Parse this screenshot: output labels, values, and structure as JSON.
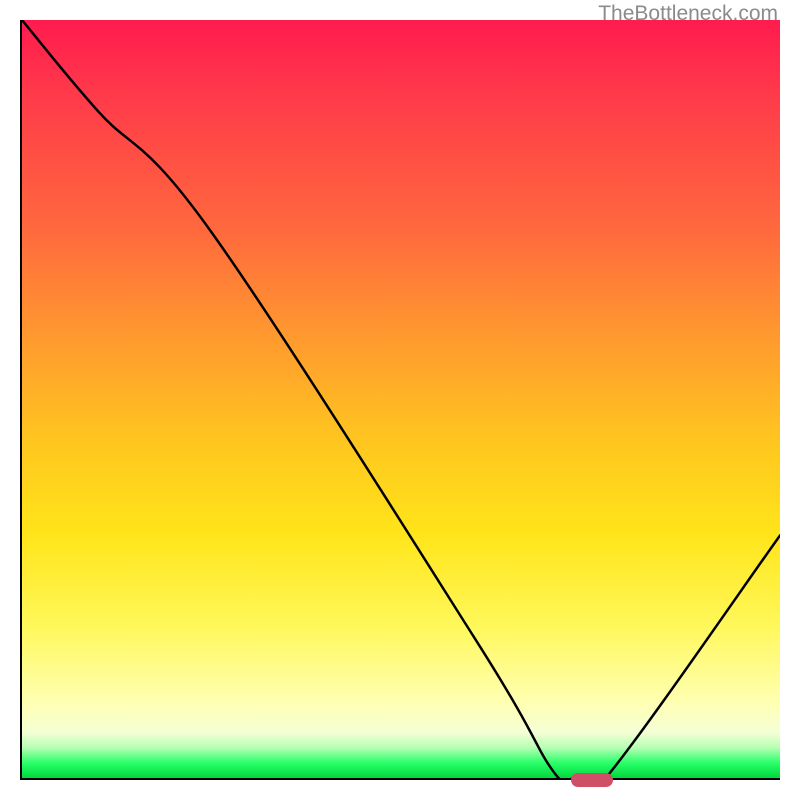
{
  "watermark": "TheBottleneck.com",
  "chart_data": {
    "type": "line",
    "title": "",
    "xlabel": "",
    "ylabel": "",
    "xlim": [
      0,
      100
    ],
    "ylim": [
      0,
      100
    ],
    "series": [
      {
        "name": "curve",
        "x": [
          0,
          10,
          25,
          60,
          70,
          73,
          77,
          100
        ],
        "values": [
          100,
          88,
          72,
          18,
          1,
          0,
          0,
          32
        ]
      }
    ],
    "gradient_stops": [
      {
        "pct": 0,
        "color": "#ff1b4e"
      },
      {
        "pct": 10,
        "color": "#ff3a4a"
      },
      {
        "pct": 28,
        "color": "#ff6a3d"
      },
      {
        "pct": 42,
        "color": "#ff9a2e"
      },
      {
        "pct": 56,
        "color": "#ffc71f"
      },
      {
        "pct": 68,
        "color": "#ffe51a"
      },
      {
        "pct": 80,
        "color": "#fff85b"
      },
      {
        "pct": 90,
        "color": "#ffffb2"
      },
      {
        "pct": 94,
        "color": "#f4ffd5"
      },
      {
        "pct": 96,
        "color": "#b6ffb3"
      },
      {
        "pct": 98,
        "color": "#2aff6a"
      },
      {
        "pct": 100,
        "color": "#00d83d"
      }
    ],
    "marker": {
      "x": 75,
      "y": 0,
      "color": "#cf5066"
    }
  }
}
